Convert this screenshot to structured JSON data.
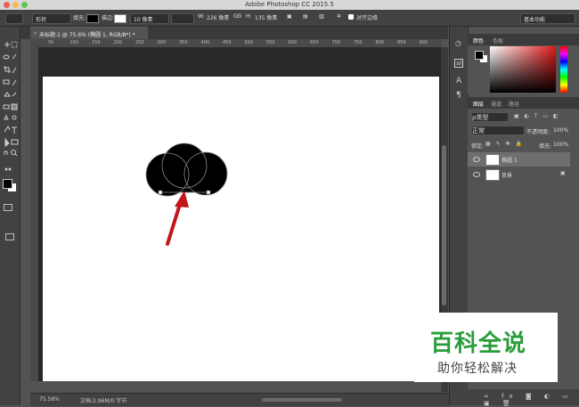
{
  "window": {
    "title": "Adobe Photoshop CC 2015.5"
  },
  "options_bar": {
    "mode": "形状",
    "fill_label": "填充:",
    "stroke_label": "描边:",
    "stroke_width": "10 像素",
    "w_label": "W:",
    "w_value": "226 像素",
    "link_label": "GĐ",
    "h_label": "H:",
    "h_value": "135 像素",
    "align_edges": "对齐边缘",
    "workspace": "基本功能"
  },
  "document": {
    "tab": "未标题-1 @ 75.6% (椭圆 1, RGB/8*) *",
    "zoom": "75.58%",
    "doc_info": "文档:2.96M/0 字节"
  },
  "ruler": {
    "marks": [
      "50",
      "100",
      "150",
      "200",
      "250",
      "300",
      "350",
      "400",
      "450",
      "500",
      "550",
      "600",
      "650",
      "700",
      "750",
      "800",
      "850",
      "900"
    ]
  },
  "color_panel": {
    "tabs": [
      "颜色",
      "色板"
    ]
  },
  "layers_panel": {
    "tabs": [
      "图层",
      "通道",
      "路径"
    ],
    "filter": "ρ类型",
    "blend_mode": "正常",
    "opacity_label": "不透明度:",
    "opacity_value": "100%",
    "lock_label": "锁定:",
    "fill_label": "填充:",
    "fill_value": "100%",
    "layers": [
      {
        "name": "椭圆 1",
        "selected": true
      },
      {
        "name": "背景",
        "selected": false
      }
    ]
  },
  "watermark": {
    "brand": "百科全说",
    "slogan": "助你轻松解决"
  },
  "colors": {
    "accent_red": "#c0161c",
    "brand_green": "#2a9d3a",
    "panel_bg": "#535353"
  },
  "icons": [
    "move-icon",
    "marquee-icon",
    "lasso-icon",
    "crop-icon",
    "eyedropper-icon",
    "brush-icon",
    "eraser-icon",
    "pen-icon",
    "type-icon",
    "shape-icon",
    "hand-icon",
    "zoom-icon",
    "eye-icon"
  ]
}
